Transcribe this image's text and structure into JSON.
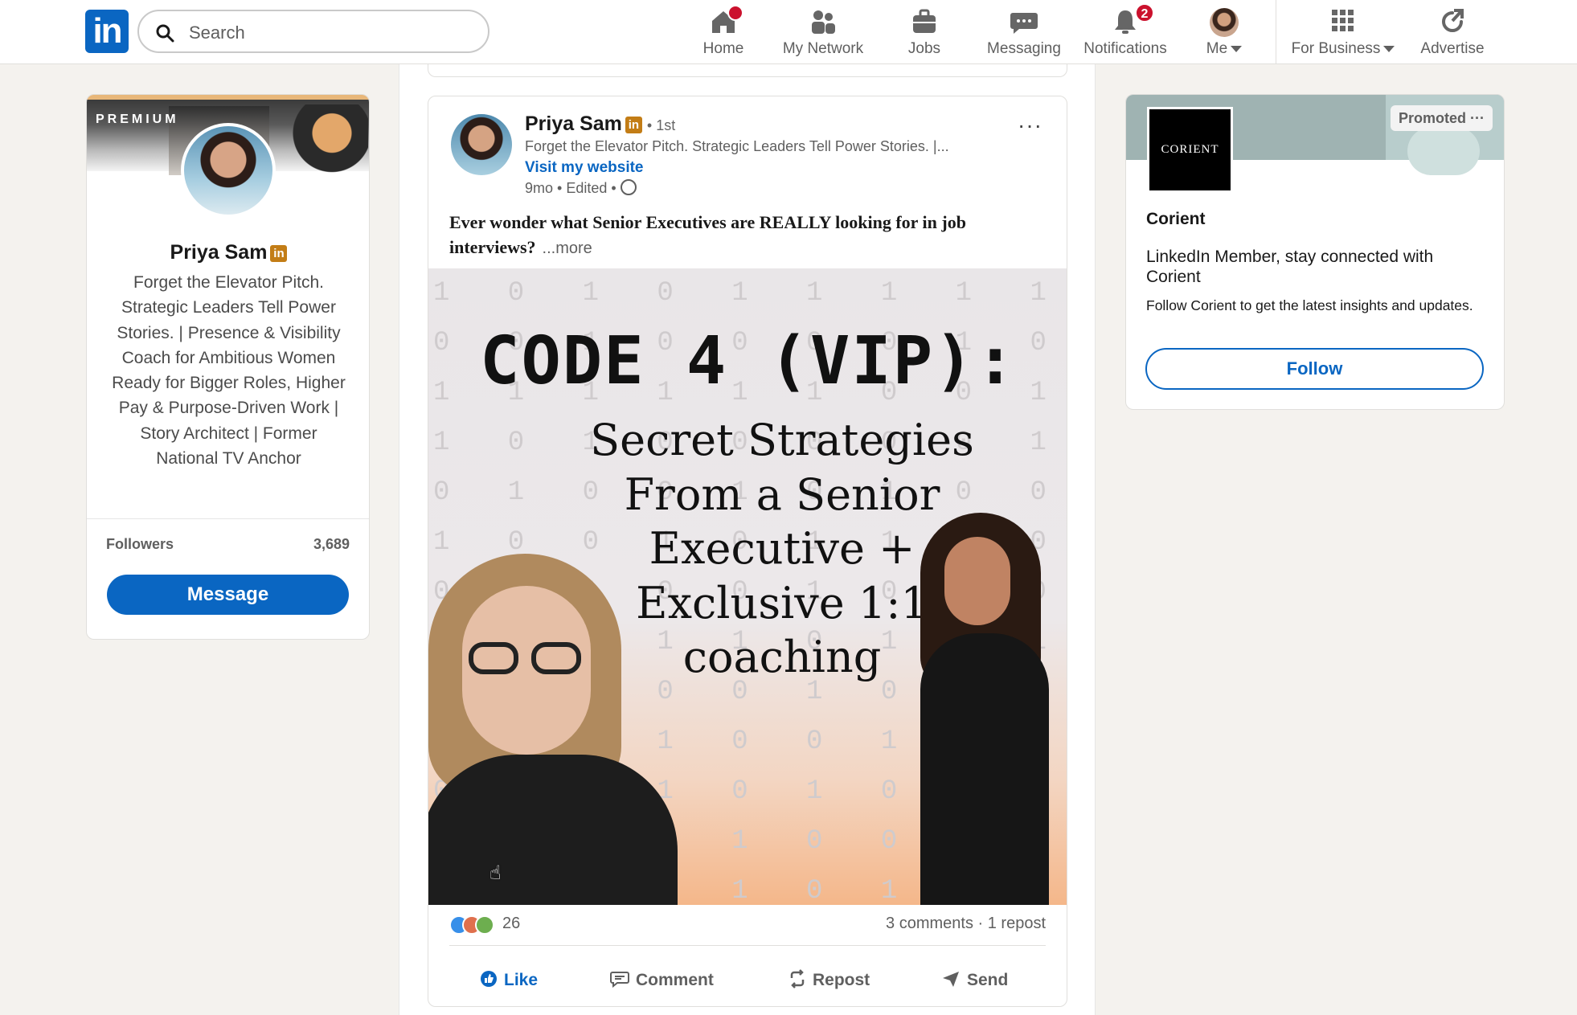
{
  "nav": {
    "logo_text": "in",
    "search_placeholder": "Search",
    "items": [
      {
        "label": "Home",
        "icon": "home-icon",
        "badge": ""
      },
      {
        "label": "My Network",
        "icon": "network-icon"
      },
      {
        "label": "Jobs",
        "icon": "briefcase-icon"
      },
      {
        "label": "Messaging",
        "icon": "messaging-icon"
      },
      {
        "label": "Notifications",
        "icon": "bell-icon",
        "badge": "2"
      },
      {
        "label": "Me",
        "icon": "avatar"
      },
      {
        "label": "For Business",
        "icon": "grid-icon"
      },
      {
        "label": "Advertise",
        "icon": "advertise-icon"
      }
    ],
    "brand_color": "#0a66c2",
    "badge_color": "#cb112d"
  },
  "profile_card": {
    "banner_label": "PREMIUM",
    "name": "Priya Sam",
    "headline": "Forget the Elevator Pitch. Strategic Leaders Tell Power Stories. | Presence & Visibility Coach for Ambitious Women Ready for Bigger Roles, Higher Pay & Purpose-Driven Work | Story Architect | Former National TV Anchor",
    "followers_label": "Followers",
    "followers_count": "3,689",
    "message_label": "Message"
  },
  "post": {
    "author": "Priya Sam",
    "degree": "• 1st",
    "subtitle": "Forget the Elevator Pitch. Strategic Leaders Tell Power Stories. |...",
    "website_link": "Visit my website",
    "time": "9mo • Edited •",
    "more_menu": "···",
    "text": "Ever wonder what Senior Executives are REALLY looking for in job interviews?",
    "see_more": "...more",
    "image": {
      "headline": "CODE 4 (VIP):",
      "subhead": "Secret Strategies From a Senior Executive + Exclusive 1:1 coaching"
    },
    "reaction_count": "26",
    "comments_reposts": "3 comments · 1 repost",
    "actions": {
      "like": "Like",
      "comment": "Comment",
      "repost": "Repost",
      "send": "Send"
    }
  },
  "promo": {
    "logo_text": "CORIENT",
    "promoted_label": "Promoted",
    "company": "Corient",
    "line1": "LinkedIn Member, stay connected with Corient",
    "line2": "Follow Corient to get the latest insights and updates.",
    "follow_label": "Follow"
  }
}
